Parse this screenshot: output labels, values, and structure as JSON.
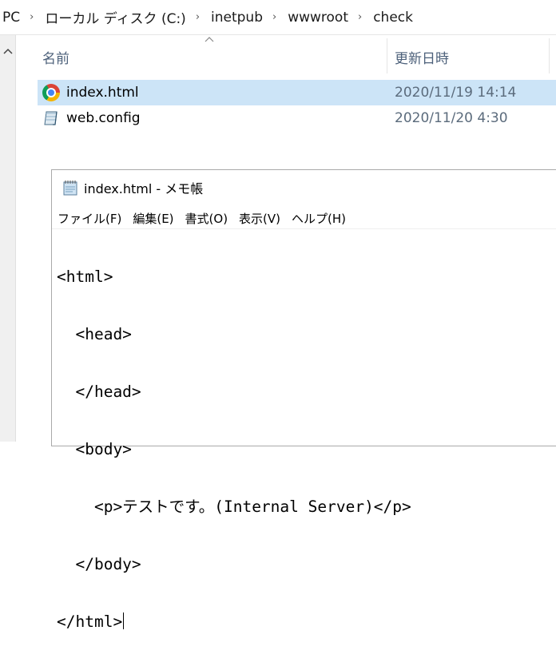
{
  "breadcrumb": {
    "items": [
      "PC",
      "ローカル ディスク (C:)",
      "inetpub",
      "wwwroot",
      "check"
    ],
    "separator": "›"
  },
  "columns": {
    "name": "名前",
    "date_modified": "更新日時"
  },
  "files": [
    {
      "name": "index.html",
      "modified": "2020/11/19 14:14",
      "icon": "chrome-icon",
      "selected": true
    },
    {
      "name": "web.config",
      "modified": "2020/11/20 4:30",
      "icon": "config-file-icon",
      "selected": false
    }
  ],
  "notepad": {
    "title": "index.html - メモ帳",
    "menu": [
      "ファイル(F)",
      "編集(E)",
      "書式(O)",
      "表示(V)",
      "ヘルプ(H)"
    ],
    "lines": [
      "<html>",
      "  <head>",
      "  </head>",
      "  <body>",
      "    <p>テストです。(Internal Server)</p>",
      "  </body>",
      "</html>"
    ]
  },
  "colors": {
    "selection": "#cce4f7",
    "header_text": "#4c607a",
    "date_text": "#5b6b7c"
  }
}
